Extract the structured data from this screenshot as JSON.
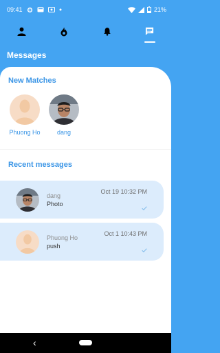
{
  "status_bar": {
    "time": "09:41",
    "battery": "21%",
    "icons": [
      "gear-icon",
      "debug-icon",
      "cast-icon",
      "dot-icon",
      "wifi-icon",
      "signal-icon",
      "battery-icon"
    ]
  },
  "tabs": [
    {
      "icon": "person-icon",
      "active": false
    },
    {
      "icon": "flame-icon",
      "active": false
    },
    {
      "icon": "bell-icon",
      "active": false
    },
    {
      "icon": "chat-icon",
      "active": true
    }
  ],
  "page_title": "Messages",
  "new_matches": {
    "title": "New Matches",
    "items": [
      {
        "name": "Phuong Ho",
        "avatar": "default-avatar"
      },
      {
        "name": "dang",
        "avatar": "photo-avatar"
      }
    ]
  },
  "recent_messages": {
    "title": "Recent messages",
    "items": [
      {
        "name": "dang",
        "preview": "Photo",
        "time": "Oct 19 10:32 PM",
        "status": "read-checkmark",
        "avatar": "photo-avatar"
      },
      {
        "name": "Phuong Ho",
        "preview": "push",
        "time": "Oct 1 10:43 PM",
        "status": "read-checkmark",
        "avatar": "default-avatar"
      }
    ]
  },
  "colors": {
    "primary": "#44a4f2",
    "accent_text": "#3a95e6",
    "card_bg": "#dcecfc"
  }
}
